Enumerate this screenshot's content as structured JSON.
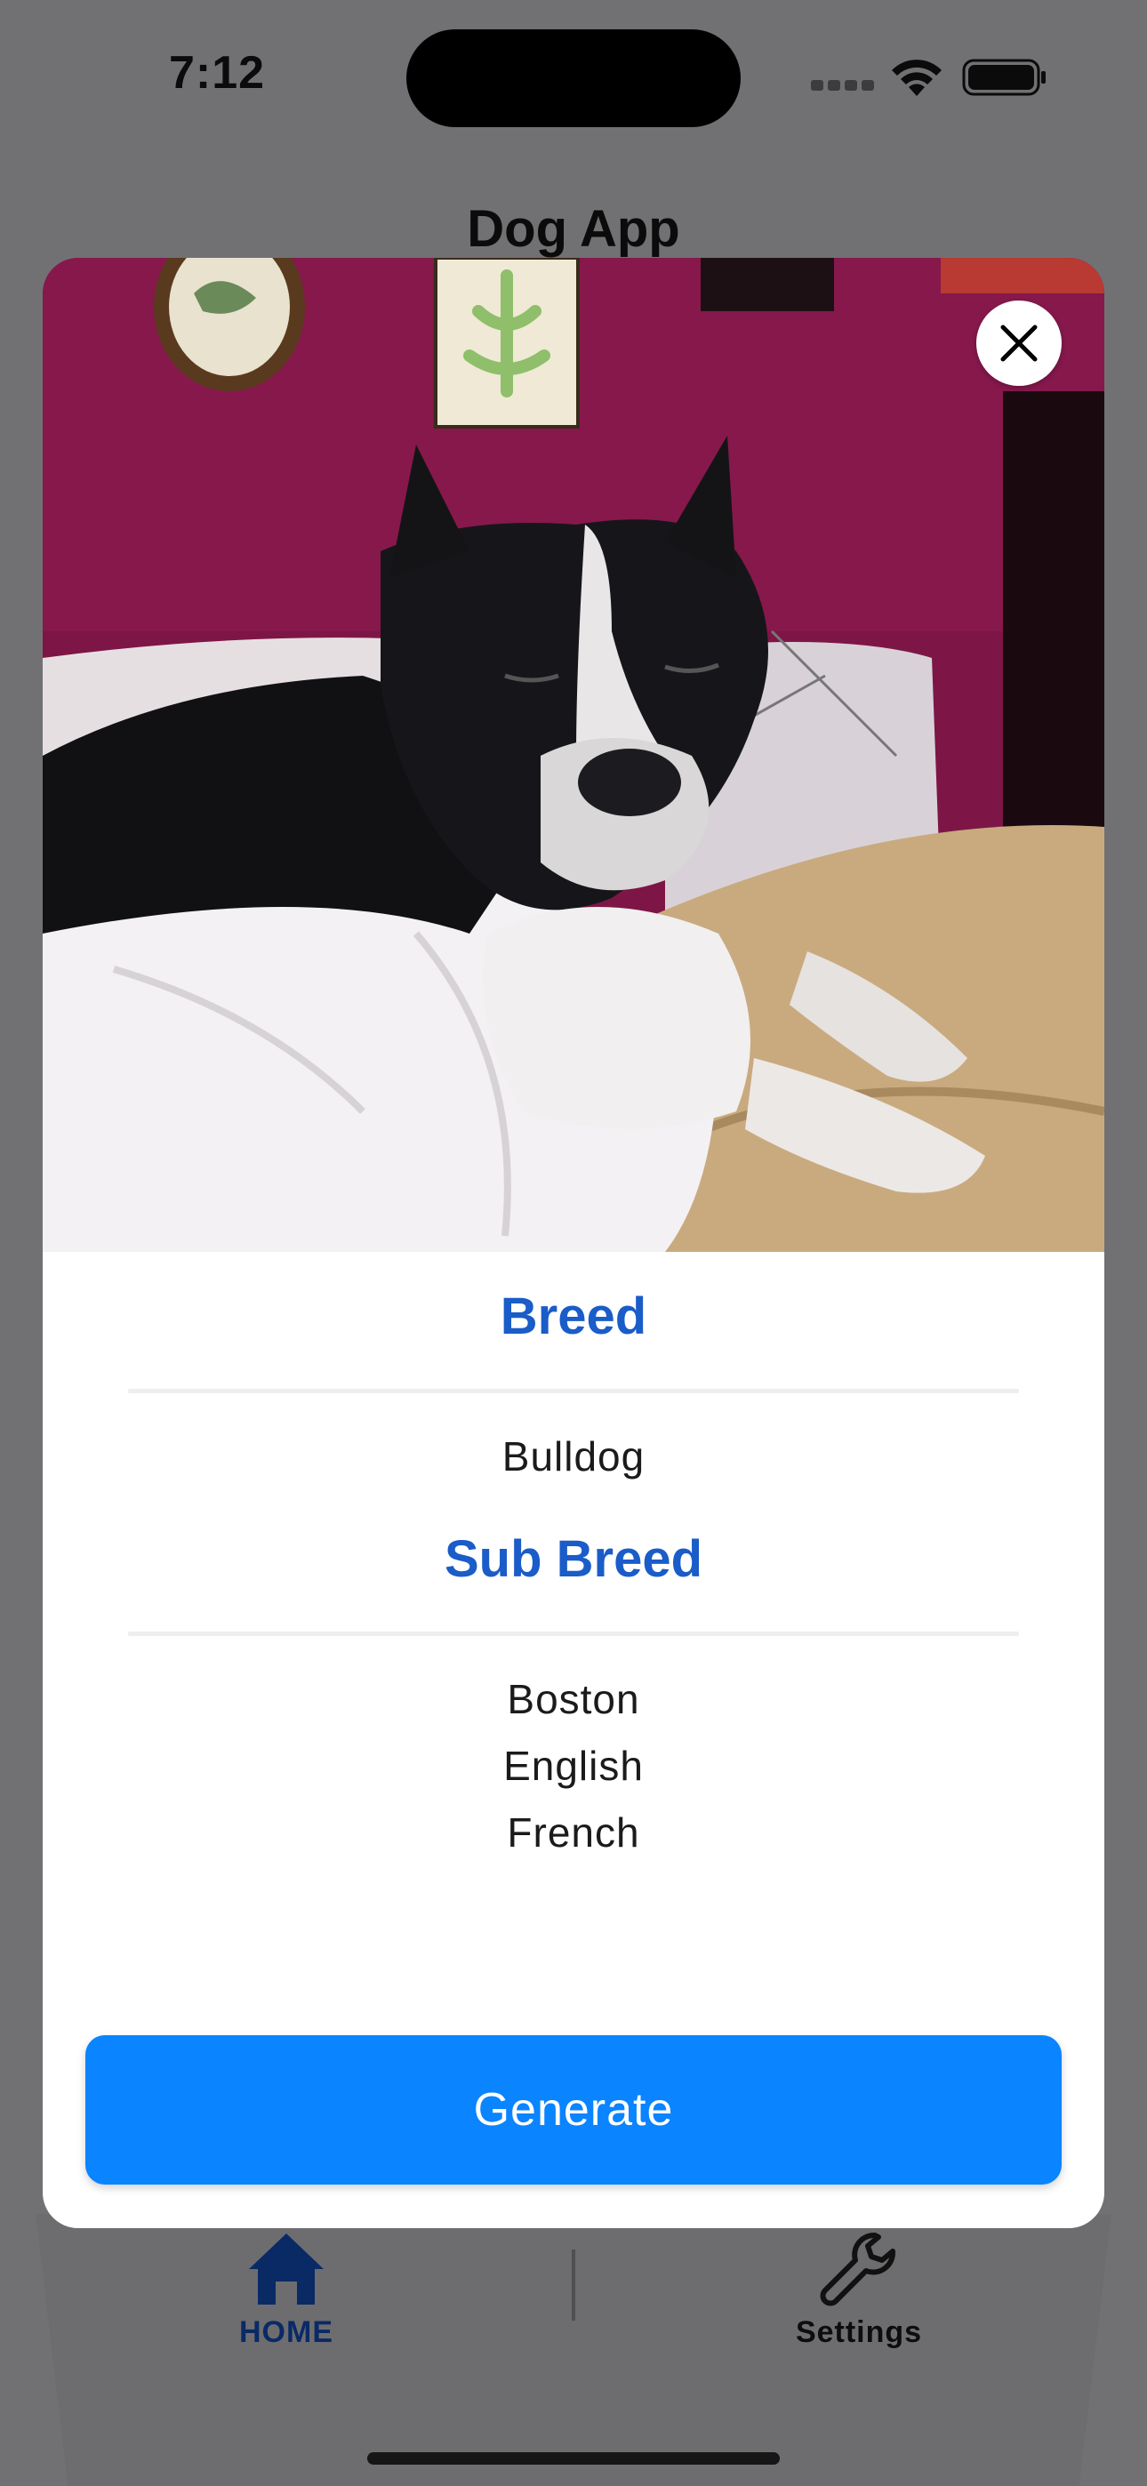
{
  "status_bar": {
    "time": "7:12"
  },
  "header": {
    "title": "Dog App"
  },
  "modal": {
    "image_alt": "Black and white dog lying in bed",
    "close_icon": "close-icon",
    "breed_heading": "Breed",
    "breed_value": "Bulldog",
    "sub_breed_heading": "Sub Breed",
    "sub_breeds": [
      "Boston",
      "English",
      "French"
    ],
    "generate_label": "Generate"
  },
  "tab_bar": {
    "items": [
      {
        "label": "HOME",
        "icon": "home-icon",
        "active": true
      },
      {
        "label": "Settings",
        "icon": "wrench-icon",
        "active": false
      }
    ]
  },
  "colors": {
    "accent": "#0a84ff",
    "heading": "#1a5cc8",
    "overlay": "#717174",
    "active_tab": "#0a2a66"
  }
}
